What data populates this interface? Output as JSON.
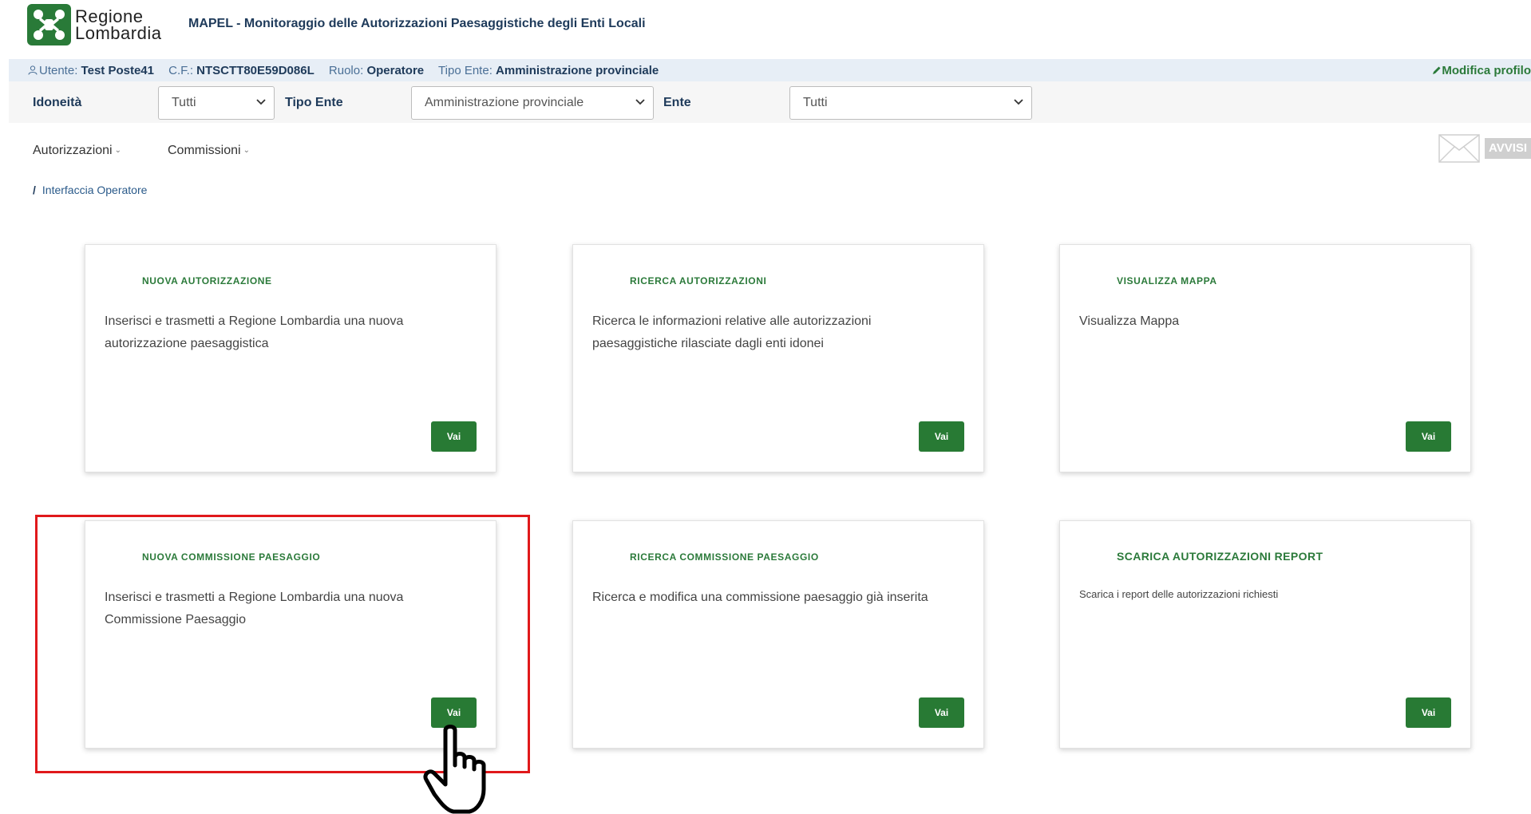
{
  "header": {
    "logo_line1": "Regione",
    "logo_line2": "Lombardia",
    "app_title": "MAPEL - Monitoraggio delle Autorizzazioni Paesaggistiche degli Enti Locali"
  },
  "userbar": {
    "user_label": "Utente:",
    "user_value": "Test Poste41",
    "cf_label": "C.F.:",
    "cf_value": "NTSCTT80E59D086L",
    "role_label": "Ruolo:",
    "role_value": "Operatore",
    "ente_type_label": "Tipo Ente:",
    "ente_type_value": "Amministrazione provinciale",
    "profile_link": "Modifica profilo"
  },
  "filters": {
    "idoneita_label": "Idoneità",
    "idoneita_value": "Tutti",
    "tipo_ente_label": "Tipo Ente",
    "tipo_ente_value": "Amministrazione provinciale",
    "ente_label": "Ente",
    "ente_value": "Tutti"
  },
  "nav": {
    "autorizzazioni": "Autorizzazioni",
    "commissioni": "Commissioni",
    "avvisi": "AVVISI"
  },
  "breadcrumb": {
    "separator": "/",
    "current": "Interfaccia Operatore"
  },
  "cards": [
    {
      "title": "NUOVA AUTORIZZAZIONE",
      "description": "Inserisci e trasmetti a Regione Lombardia una nuova autorizzazione paesaggistica",
      "button": "Vai"
    },
    {
      "title": "RICERCA AUTORIZZAZIONI",
      "description": "Ricerca le informazioni relative alle autorizzazioni paesaggistiche rilasciate dagli enti idonei",
      "button": "Vai"
    },
    {
      "title": "VISUALIZZA MAPPA",
      "description": "Visualizza Mappa",
      "button": "Vai"
    },
    {
      "title": "NUOVA COMMISSIONE PAESAGGIO",
      "description": "Inserisci e trasmetti a Regione Lombardia una nuova Commissione Paesaggio",
      "button": "Vai"
    },
    {
      "title": "RICERCA COMMISSIONE PAESAGGIO",
      "description": "Ricerca e modifica una commissione paesaggio già inserita",
      "button": "Vai"
    },
    {
      "title": "SCARICA AUTORIZZAZIONI REPORT",
      "description": "Scarica i report delle autorizzazioni richiesti",
      "button": "Vai"
    }
  ],
  "colors": {
    "brand_green": "#287a34",
    "title_blue": "#1e3a5a",
    "highlight_red": "#e0191b"
  }
}
